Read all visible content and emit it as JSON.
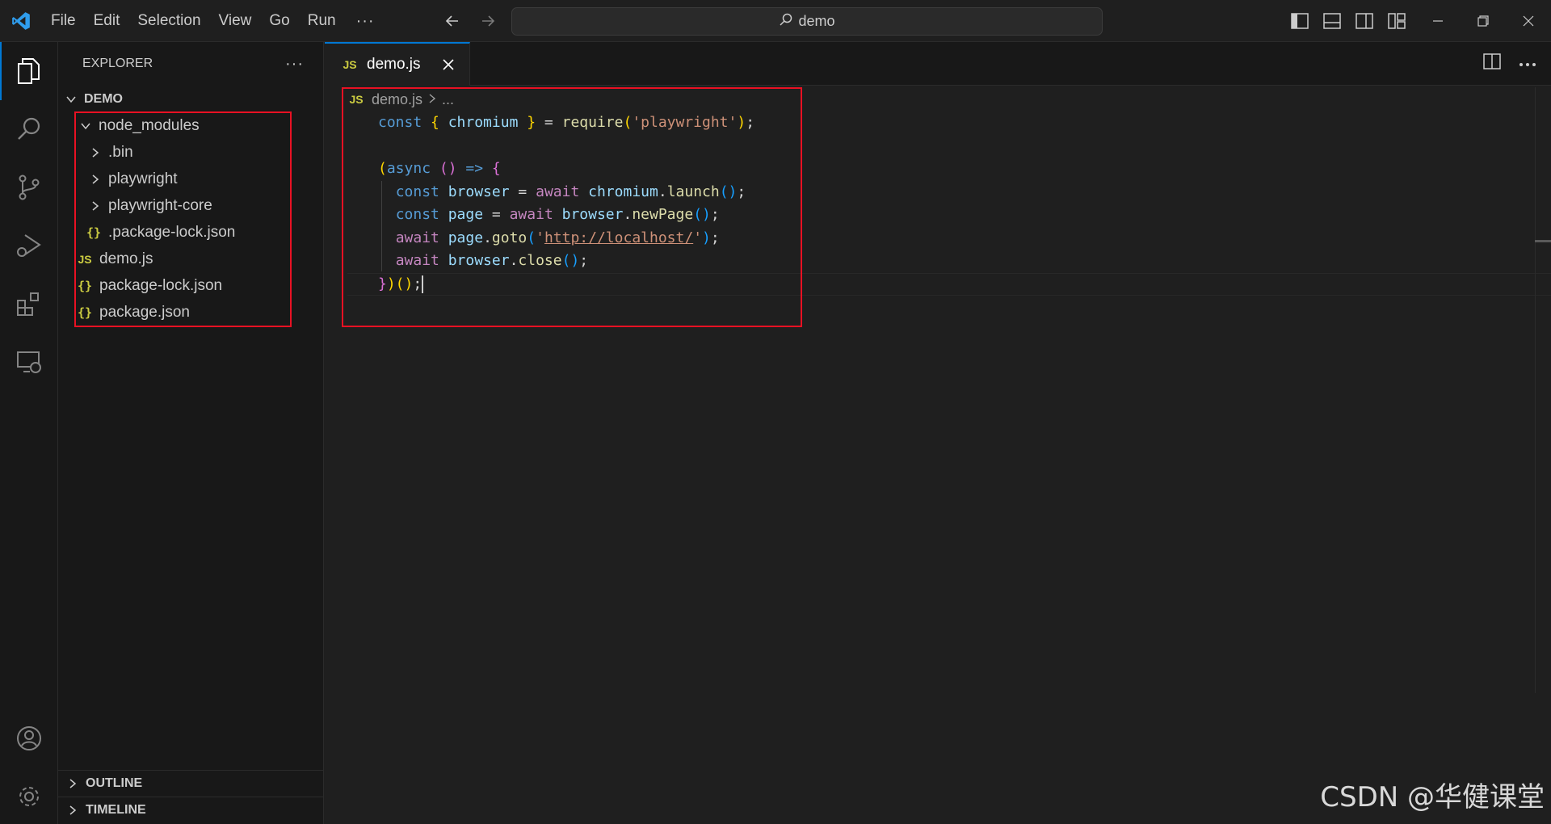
{
  "titlebar": {
    "menu": [
      "File",
      "Edit",
      "Selection",
      "View",
      "Go",
      "Run"
    ],
    "more": "···",
    "search_text": "demo"
  },
  "sidebar": {
    "title": "EXPLORER",
    "more": "···",
    "root": "DEMO",
    "tree": [
      {
        "label": "node_modules",
        "icon": "chevron-down-icon",
        "depth": 1
      },
      {
        "label": ".bin",
        "icon": "chevron-right-icon",
        "depth": 2
      },
      {
        "label": "playwright",
        "icon": "chevron-right-icon",
        "depth": 2
      },
      {
        "label": "playwright-core",
        "icon": "chevron-right-icon",
        "depth": 2
      },
      {
        "label": ".package-lock.json",
        "icon": "json-file-icon",
        "icon_text": "{}",
        "depth": 2
      },
      {
        "label": "demo.js",
        "icon": "js-file-icon",
        "icon_text": "JS",
        "depth": 1
      },
      {
        "label": "package-lock.json",
        "icon": "json-file-icon",
        "icon_text": "{}",
        "depth": 1
      },
      {
        "label": "package.json",
        "icon": "json-file-icon",
        "icon_text": "{}",
        "depth": 1
      }
    ],
    "sections": [
      "OUTLINE",
      "TIMELINE"
    ]
  },
  "editor": {
    "tab": {
      "label": "demo.js",
      "icon_text": "JS"
    },
    "breadcrumbs": {
      "file": "demo.js",
      "separator": ">",
      "rest": "..."
    },
    "code_lines": [
      "const { chromium } = require('playwright');",
      "",
      "(async () => {",
      "  const browser = await chromium.launch();",
      "  const page = await browser.newPage();",
      "  await page.goto('http://localhost/');",
      "  await browser.close();",
      "})();"
    ]
  },
  "watermark": "CSDN @华健课堂",
  "colors": {
    "accent": "#0078d4",
    "highlight_box": "#e81123",
    "js_icon": "#cbcb41"
  }
}
